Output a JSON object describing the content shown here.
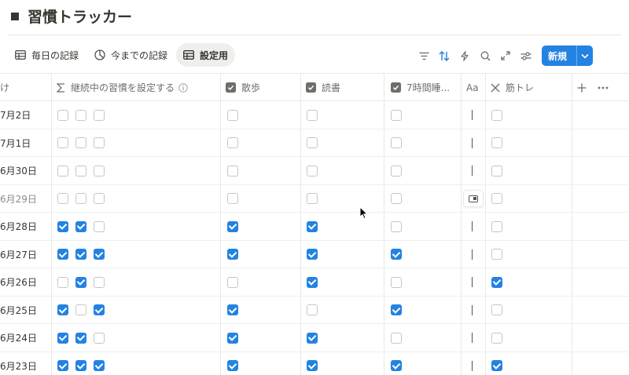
{
  "page": {
    "title": "習慣トラッカー"
  },
  "tabs": [
    {
      "label": "毎日の記録",
      "icon": "table-icon"
    },
    {
      "label": "今までの記録",
      "icon": "chart-icon"
    },
    {
      "label": "設定用",
      "icon": "table-icon",
      "active": true
    }
  ],
  "toolbar": {
    "icons": [
      "filter-icon",
      "sort-icon",
      "automation-icon",
      "search-icon",
      "expand-icon",
      "settings-icon"
    ],
    "new_label": "新規"
  },
  "columns": {
    "cut_header": "け",
    "streak": "継続中の習慣を設定する",
    "walk": "散歩",
    "reading": "読書",
    "sleep": "7時間睡...",
    "text_type": "Aa",
    "workout": "筋トレ"
  },
  "rows": [
    {
      "date": "7月2日",
      "streak": [
        false,
        false,
        false
      ],
      "walk": false,
      "reading": false,
      "sleep": false,
      "workout": false
    },
    {
      "date": "7月1日",
      "streak": [
        false,
        false,
        false
      ],
      "walk": false,
      "reading": false,
      "sleep": false,
      "workout": false
    },
    {
      "date": "6月30日",
      "streak": [
        false,
        false,
        false
      ],
      "walk": false,
      "reading": false,
      "sleep": false,
      "workout": false
    },
    {
      "date": "6月29日",
      "streak": [
        false,
        false,
        false
      ],
      "walk": false,
      "reading": false,
      "sleep": false,
      "workout": false,
      "muted": true,
      "editing": true
    },
    {
      "date": "6月28日",
      "streak": [
        true,
        true,
        false
      ],
      "walk": true,
      "reading": true,
      "sleep": false,
      "workout": false
    },
    {
      "date": "6月27日",
      "streak": [
        true,
        true,
        true
      ],
      "walk": true,
      "reading": true,
      "sleep": true,
      "workout": false
    },
    {
      "date": "6月26日",
      "streak": [
        false,
        true,
        false
      ],
      "walk": false,
      "reading": true,
      "sleep": false,
      "workout": true
    },
    {
      "date": "6月25日",
      "streak": [
        true,
        false,
        true
      ],
      "walk": true,
      "reading": false,
      "sleep": true,
      "workout": false
    },
    {
      "date": "6月24日",
      "streak": [
        true,
        true,
        false
      ],
      "walk": true,
      "reading": true,
      "sleep": false,
      "workout": false
    },
    {
      "date": "6月23日",
      "streak": [
        true,
        true,
        true
      ],
      "walk": true,
      "reading": true,
      "sleep": true,
      "workout": true
    }
  ],
  "colors": {
    "accent": "#2383e2",
    "text": "#37352f",
    "muted": "#8c8b87",
    "border": "#e9e9e7"
  }
}
